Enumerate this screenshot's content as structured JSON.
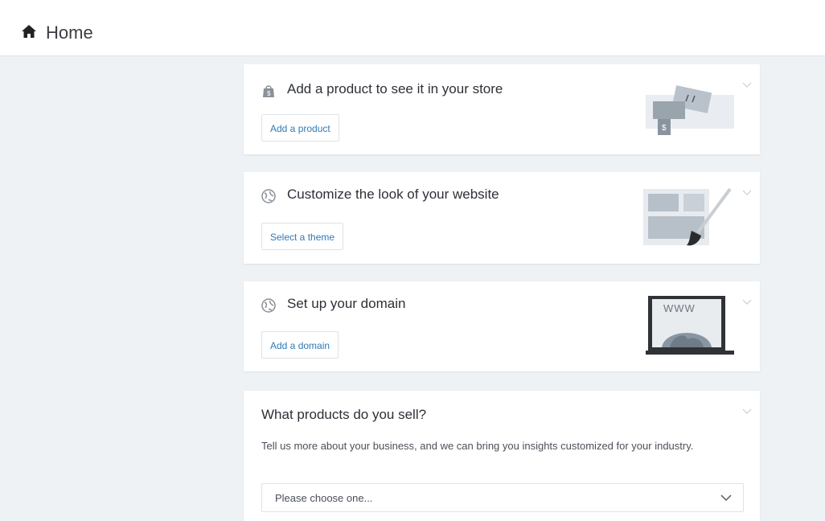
{
  "header": {
    "title": "Home",
    "icon": "home-icon"
  },
  "cards": [
    {
      "title": "Add a product to see it in your store",
      "icon": "shopping-bag-icon",
      "button": "Add a product",
      "illustration": "price-tag-illustration"
    },
    {
      "title": "Customize the look of your website",
      "icon": "globe-icon",
      "button": "Select a theme",
      "illustration": "theme-brush-illustration"
    },
    {
      "title": "Set up your domain",
      "icon": "globe-icon",
      "button": "Add a domain",
      "illustration": "www-laptop-illustration",
      "illustration_text": "WWW"
    }
  ],
  "survey": {
    "title": "What products do you sell?",
    "description": "Tell us more about your business, and we can bring you insights customized for your industry.",
    "select_value": "Please choose one..."
  },
  "colors": {
    "link": "#2f7ab8",
    "background": "#eef2f5",
    "card": "#ffffff"
  }
}
